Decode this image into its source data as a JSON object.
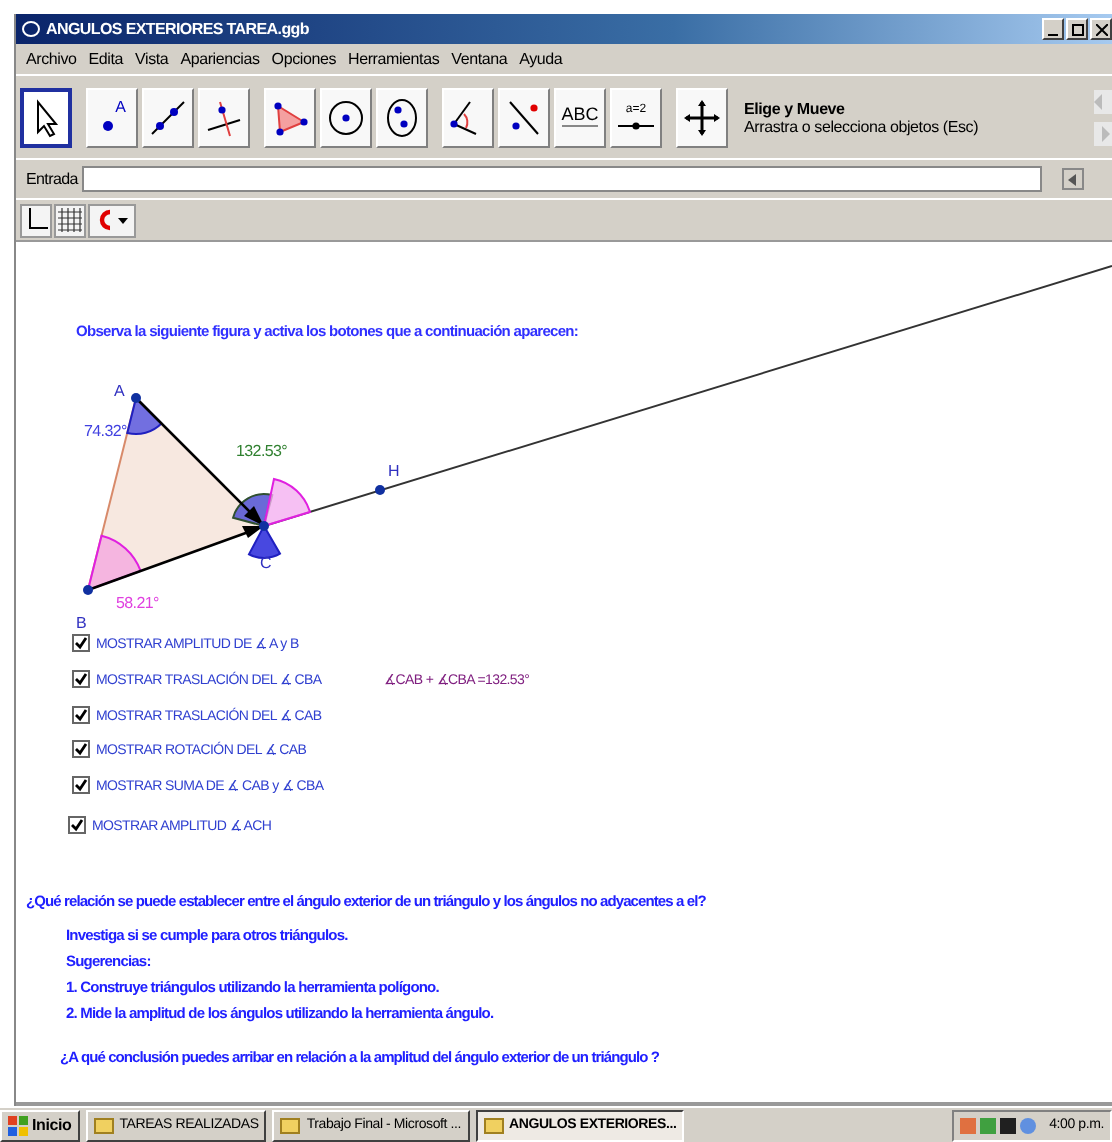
{
  "window": {
    "title": "ANGULOS EXTERIORES TAREA.ggb"
  },
  "menu": [
    "Archivo",
    "Edita",
    "Vista",
    "Apariencias",
    "Opciones",
    "Herramientas",
    "Ventana",
    "Ayuda"
  ],
  "toolbar": {
    "tools": [
      {
        "selected": true
      },
      {
        "selected": false,
        "glyph": "A"
      },
      {
        "selected": false
      },
      {
        "selected": false
      },
      {
        "selected": false
      },
      {
        "selected": false
      },
      {
        "selected": false
      },
      {
        "selected": false
      },
      {
        "selected": false
      },
      {
        "selected": false,
        "glyph": "ABC"
      },
      {
        "selected": false,
        "glyph": "a=2"
      },
      {
        "selected": false
      }
    ],
    "tool_title": "Elige y Mueve",
    "tool_description": "Arrastra o selecciona objetos (Esc)"
  },
  "input_bar": {
    "label": "Entrada"
  },
  "canvas": {
    "heading": "Observa la siguiente figura y activa los botones que a continuación aparecen:",
    "points": [
      {
        "label": "A"
      },
      {
        "label": "B"
      },
      {
        "label": "C"
      },
      {
        "label": "H"
      }
    ],
    "angle_labels": [
      {
        "text": "74.32°",
        "color": "#4040e0"
      },
      {
        "text": "132.53°",
        "color": "#308030"
      },
      {
        "text": "58.21°",
        "color": "#e040e0"
      }
    ],
    "checkboxes": [
      {
        "label": "MOSTRAR AMPLITUD DE ∡ A y B",
        "checked": true
      },
      {
        "label": "MOSTRAR TRASLACIÓN DEL ∡ CBA",
        "checked": true
      },
      {
        "label": "MOSTRAR TRASLACIÓN DEL ∡ CAB",
        "checked": true
      },
      {
        "label": "MOSTRAR ROTACIÓN DEL ∡ CAB",
        "checked": true
      },
      {
        "label": "MOSTRAR SUMA DE ∡ CAB y ∡ CBA",
        "checked": true
      },
      {
        "label": "MOSTRAR AMPLITUD ∡ ACH",
        "checked": true
      }
    ],
    "sum_text": "∡CAB + ∡CBA =132.53°",
    "question": "¿Qué relación se puede establecer entre el ángulo exterior de un triángulo y los ángulos no adyacentes a el?",
    "instructions": [
      "Investiga si se cumple para otros triángulos.",
      "Sugerencias:",
      "1. Construye triángulos utilizando la herramienta polígono.",
      "2. Mide la amplitud de los ángulos utilizando la herramienta ángulo."
    ],
    "conclusion": "¿A qué conclusión puedes arribar en relación a la amplitud del ángulo exterior de un triángulo ?"
  },
  "taskbar": {
    "start": "Inicio",
    "tasks": [
      {
        "label": "TAREAS REALIZADAS",
        "selected": false
      },
      {
        "label": "Trabajo Final - Microsoft ...",
        "selected": false
      },
      {
        "label": "ANGULOS EXTERIORES...",
        "selected": true
      }
    ],
    "clock": "4:00 p.m."
  }
}
